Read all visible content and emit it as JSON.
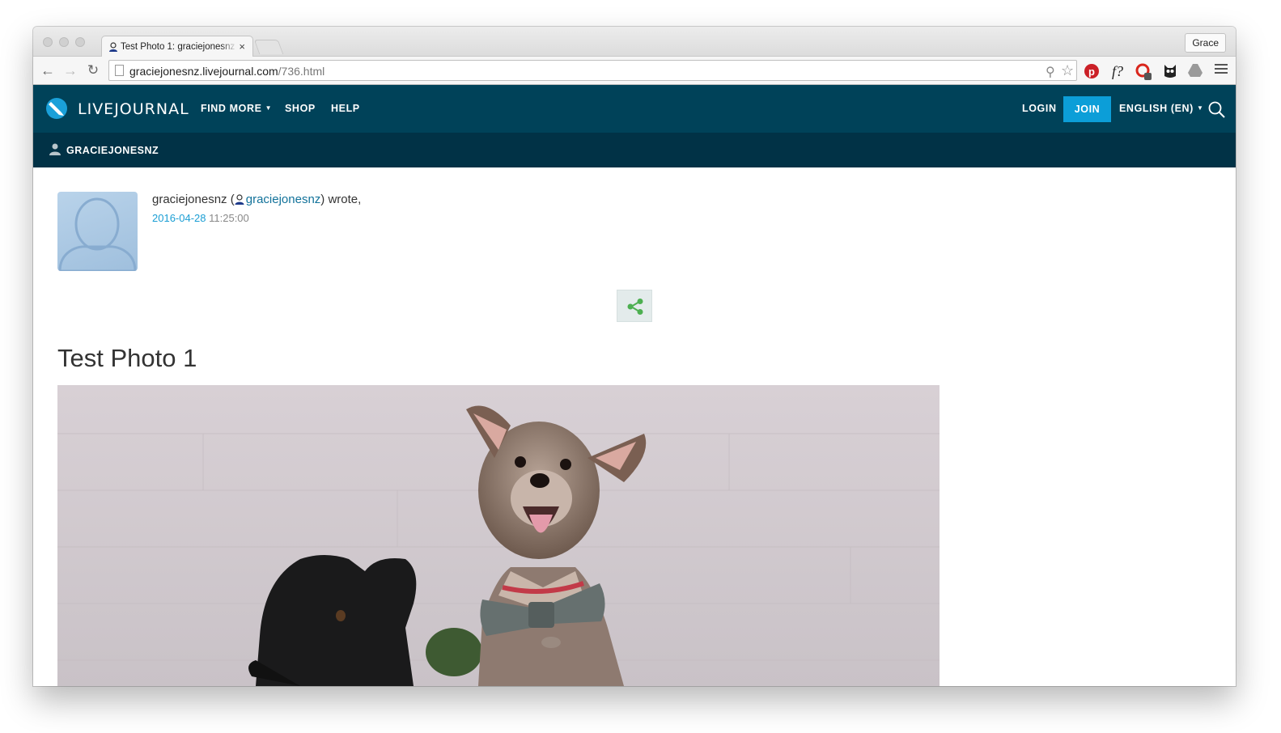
{
  "browser": {
    "tab_title": "Test Photo 1: graciejonesnz",
    "tab_close": "×",
    "profile_name": "Grace",
    "url_domain": "graciejonesnz.livejournal.com",
    "url_path": "/736.html"
  },
  "header": {
    "logo_text": "LIVEJOURNAL",
    "nav": {
      "find_more": "FIND MORE",
      "shop": "SHOP",
      "help": "HELP"
    },
    "login": "LOGIN",
    "join": "JOIN",
    "language": "ENGLISH (EN)"
  },
  "subheader": {
    "username": "GRACIEJONESNZ"
  },
  "post": {
    "author_plain": "graciejonesnz",
    "author_link": "graciejonesnz",
    "wrote": "wrote,",
    "date": "2016-04-28",
    "time": "11:25:00",
    "title": "Test Photo 1"
  },
  "colors": {
    "header_bg": "#004259",
    "subheader_bg": "#013246",
    "join_bg": "#0c9ed8",
    "link": "#12729a",
    "date_link": "#1a9ed4",
    "share_icon": "#4caf50"
  }
}
